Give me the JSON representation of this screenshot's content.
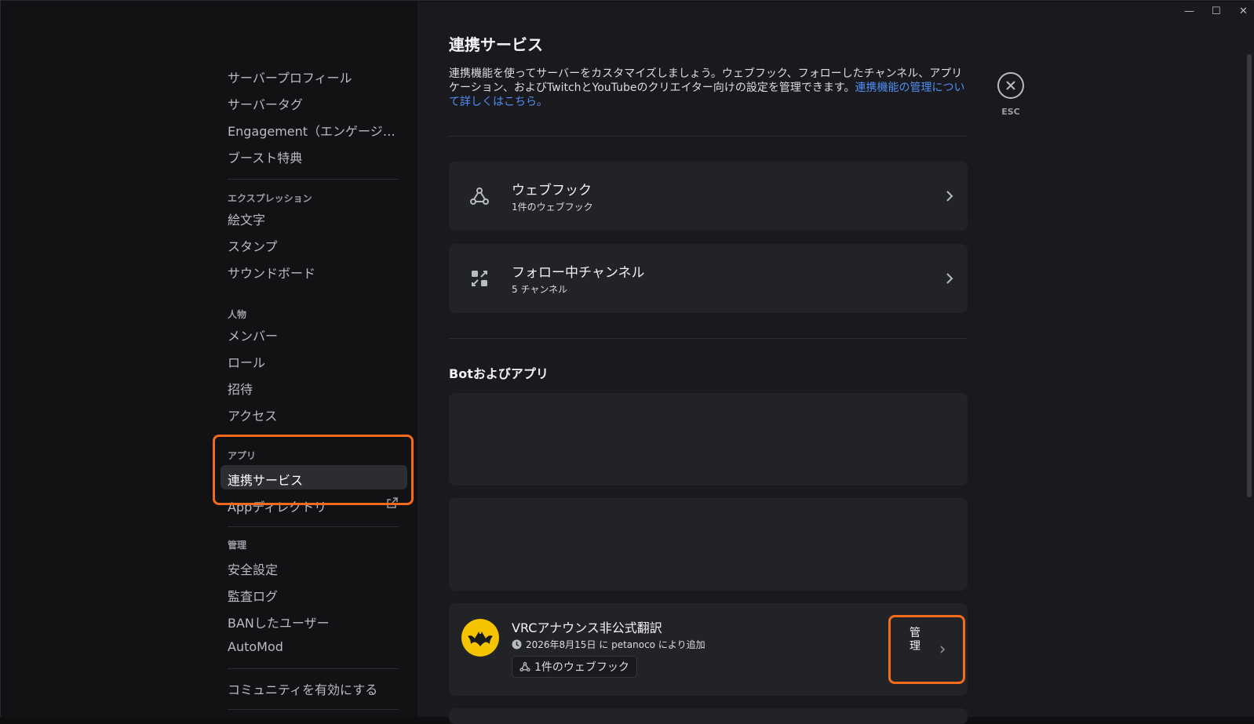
{
  "window_controls": {
    "minimize": "—",
    "maximize": "☐",
    "close": "✕"
  },
  "sidebar": {
    "server_items": [
      "サーバープロフィール",
      "サーバータグ",
      "Engagement（エンゲージメ…",
      "ブースト特典"
    ],
    "expressions_header": "エクスプレッション",
    "expressions_items": [
      "絵文字",
      "スタンプ",
      "サウンドボード"
    ],
    "people_header": "人物",
    "people_items": [
      "メンバー",
      "ロール",
      "招待",
      "アクセス"
    ],
    "apps_header": "アプリ",
    "apps_items": [
      "連携サービス",
      "Appディレクトリ"
    ],
    "moderation_header": "管理",
    "moderation_items": [
      "安全設定",
      "監査ログ",
      "BANしたユーザー",
      "AutoMod"
    ],
    "community_item": "コミュニティを有効にする"
  },
  "main": {
    "title": "連携サービス",
    "description": "連携機能を使ってサーバーをカスタマイズしましょう。ウェブフック、フォローしたチャンネル、アプリケーション、およびTwitchとYouTubeのクリエイター向けの設定を管理できます。",
    "description_link": "連携機能の管理について詳しくはこちら。",
    "esc_label": "ESC",
    "webhooks": {
      "title": "ウェブフック",
      "subtitle": "1件のウェブフック",
      "icon": "webhook-icon"
    },
    "followed_channels": {
      "title": "フォロー中チャンネル",
      "subtitle": "5 チャンネル",
      "icon": "follow-channel-icon"
    },
    "bots_section_title": "Botおよびアプリ",
    "bot": {
      "name": "VRCアナウンス非公式翻訳",
      "added_info": "2026年8月15日 に petanoco により追加",
      "webhook_tag": "1件のウェブフック",
      "manage_label": "管理"
    }
  },
  "colors": {
    "accent_link": "#4d8ff6",
    "highlight": "#f26a1b",
    "avatar_bg": "#f5c400"
  }
}
